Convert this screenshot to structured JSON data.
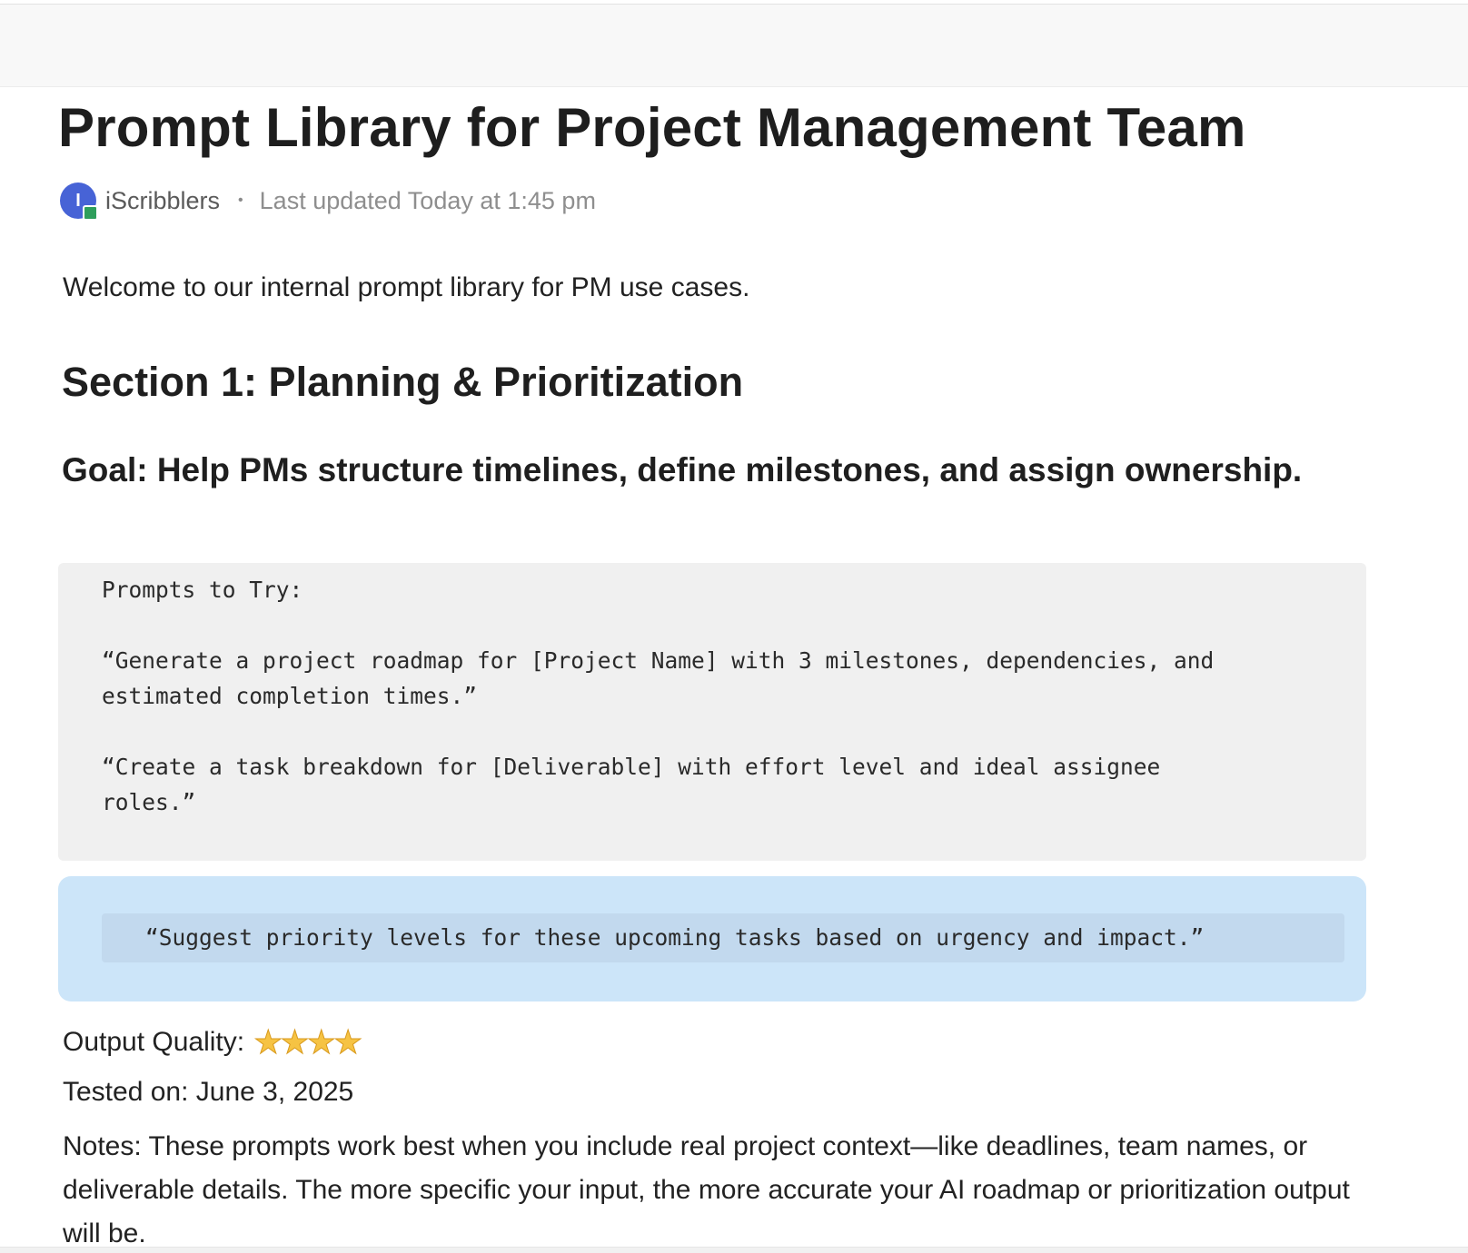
{
  "document": {
    "title": "Prompt Library for Project Management Team",
    "author": {
      "initial": "I",
      "name": "iScribblers",
      "separator": "•",
      "last_updated": "Last updated Today at 1:45 pm"
    },
    "intro": "Welcome to our internal prompt library for PM use cases.",
    "section": {
      "heading": "Section 1: Planning & Prioritization",
      "goal": "Goal: Help PMs structure timelines, define milestones, and assign ownership.",
      "code_block": {
        "header": "Prompts to Try:",
        "prompts": [
          "“Generate a project roadmap for [Project Name] with 3 milestones, dependencies, and\nestimated completion times.”",
          "“Create a task breakdown for [Deliverable] with effort level and ideal assignee\nroles.”"
        ]
      },
      "callout": {
        "prompt": "“Suggest priority levels for these upcoming tasks based on urgency and impact.”"
      },
      "output_quality": {
        "label": "Output Quality:",
        "rating": 4,
        "max_shown": 4,
        "icon": "star-icon"
      },
      "tested_on": "Tested on: June 3, 2025",
      "notes": "Notes: These prompts work best when you include real project context—like deadlines, team names, or deliverable details. The more specific your input, the more accurate your AI roadmap or prioritization output will be."
    }
  },
  "colors": {
    "avatar": "#4763d6",
    "presence": "#2e9e5b",
    "code_bg": "#f0f0f0",
    "callout_bg": "#cce5f9",
    "callout_inner_bg": "#c2d9ee",
    "star": "#f6c343"
  }
}
